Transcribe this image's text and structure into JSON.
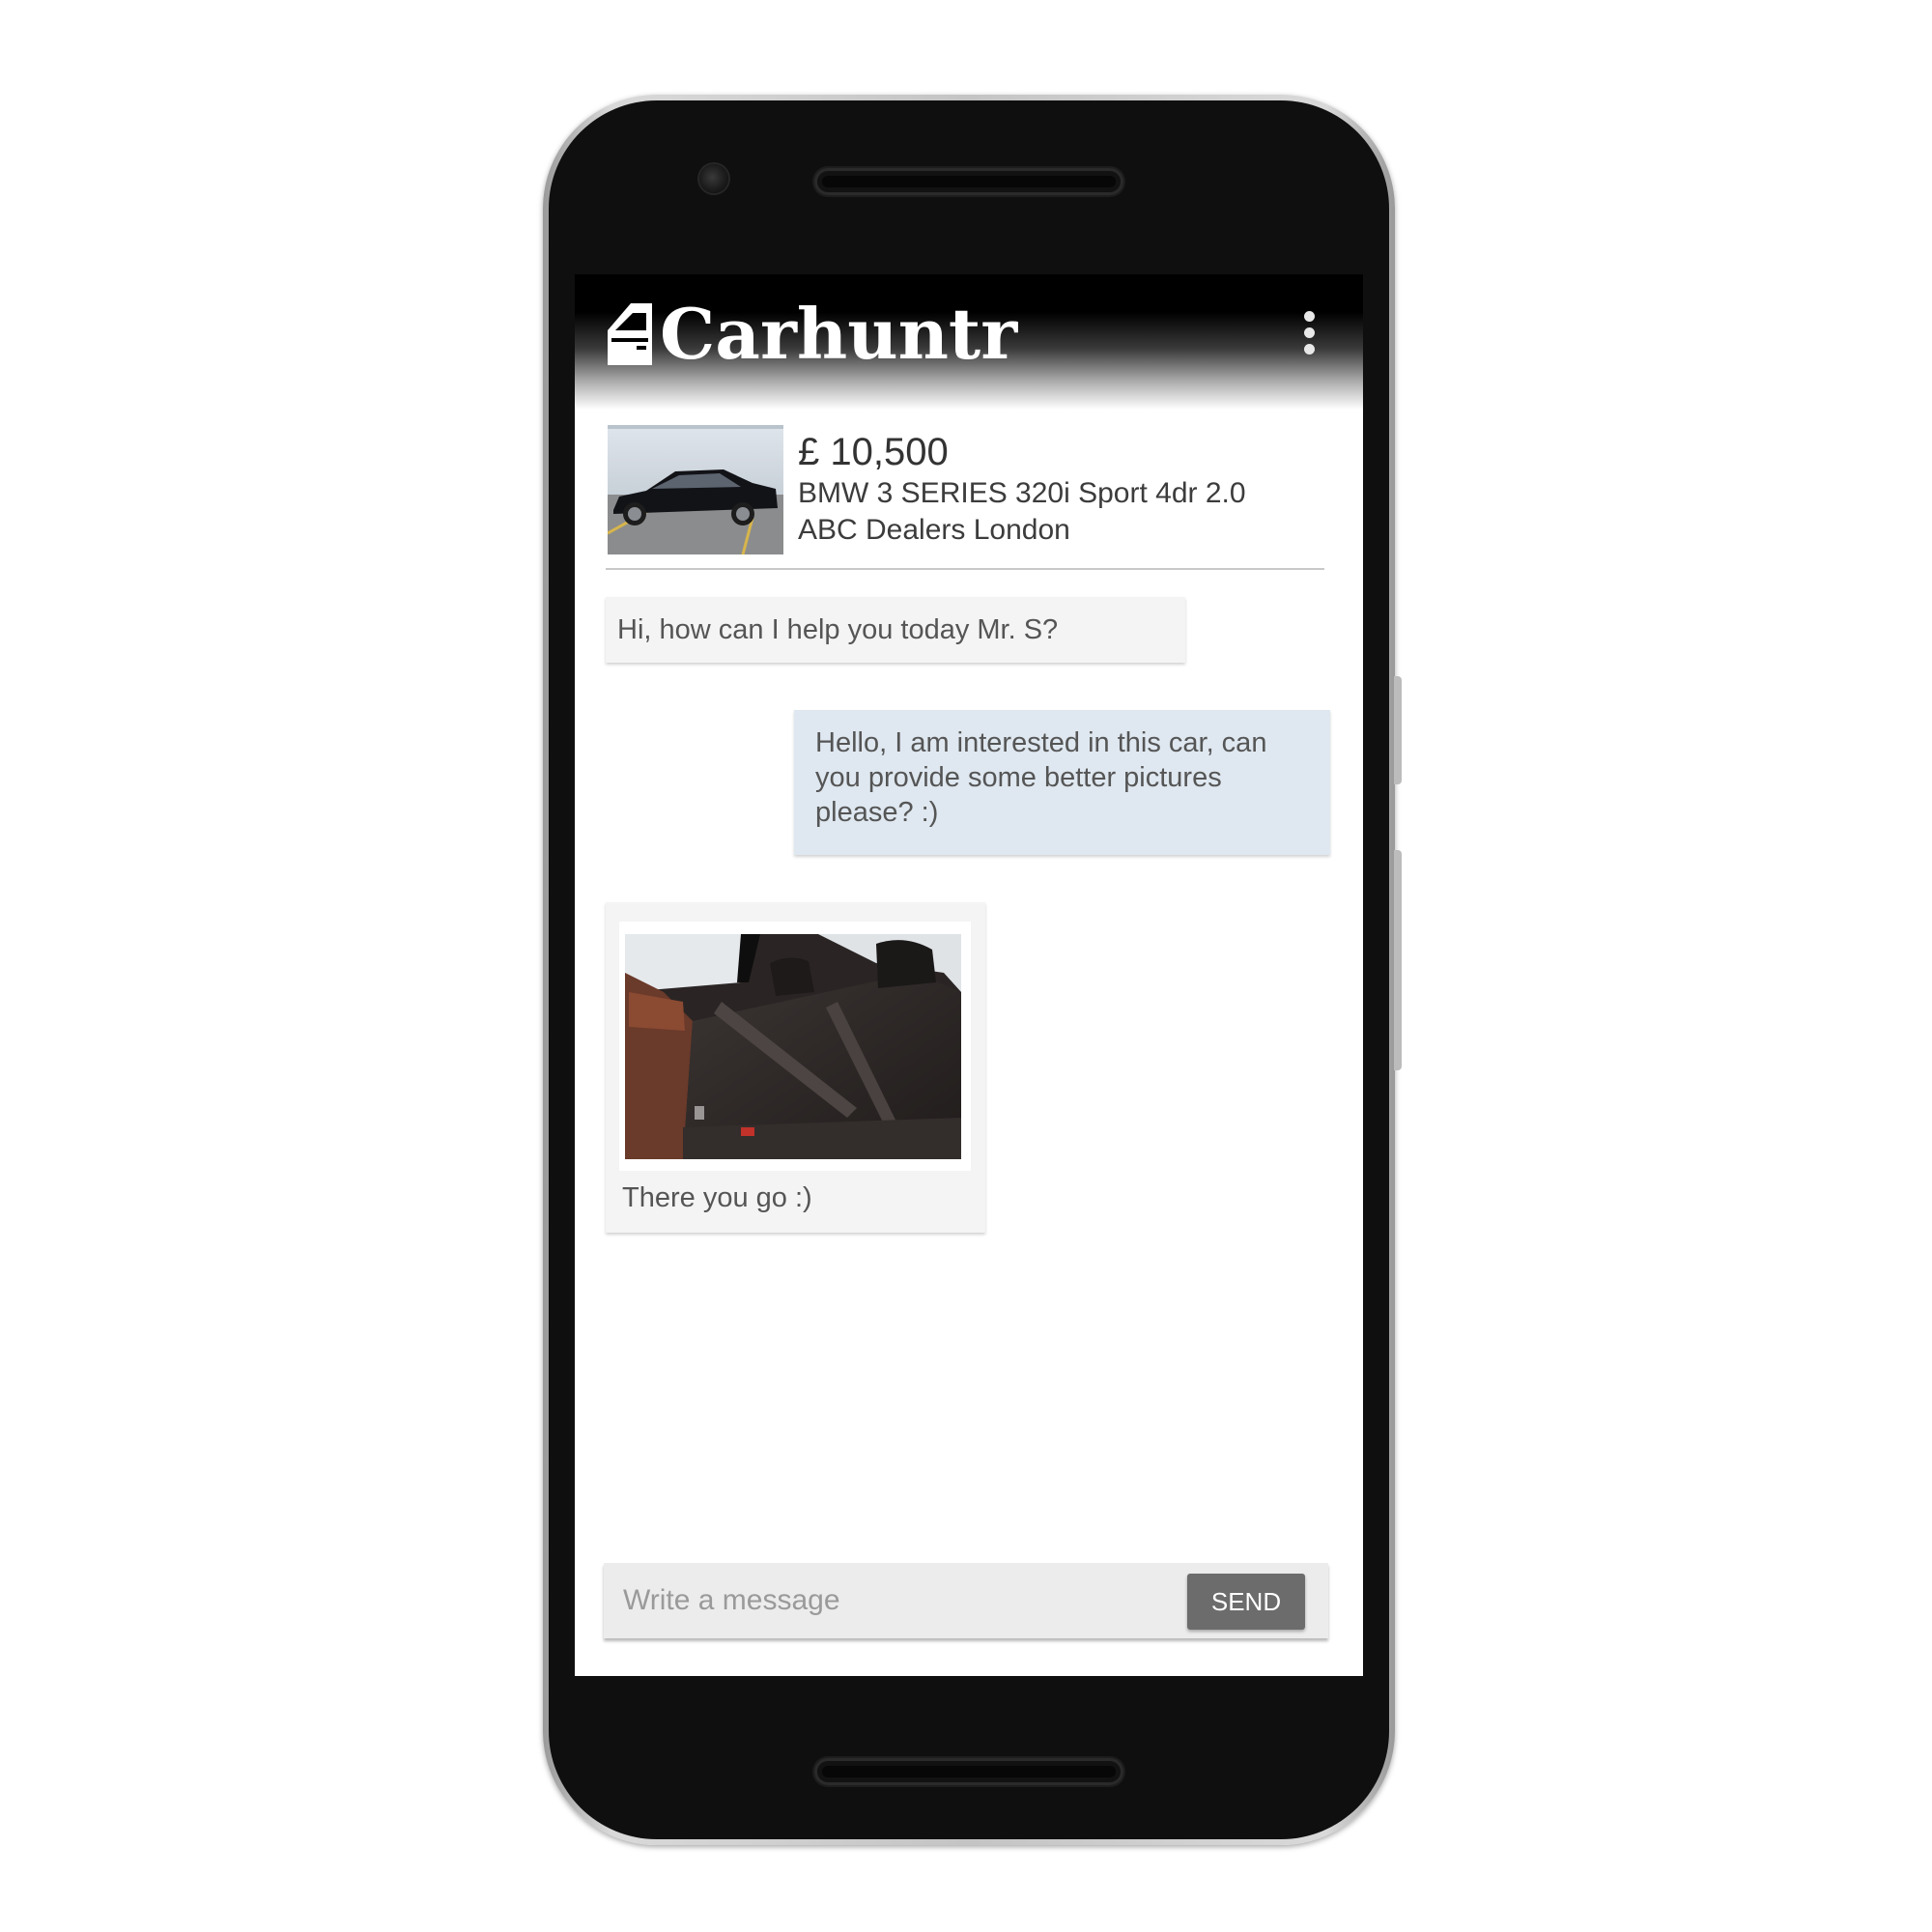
{
  "app": {
    "name": "Carhuntr",
    "logo_icon": "car-door-icon",
    "menu_icon": "more-vertical-icon",
    "colors": {
      "app_bar": "#000000",
      "incoming_bubble": "#f4f4f4",
      "outgoing_bubble": "#dfe8f0",
      "send_button": "#6c6c6c"
    }
  },
  "listing": {
    "price": "£ 10,500",
    "title": "BMW 3 SERIES 320i Sport 4dr 2.0",
    "dealer": "ABC Dealers London",
    "thumbnail_icon": "car-photo"
  },
  "messages": [
    {
      "direction": "incoming",
      "text": "Hi, how can I help you today Mr. S?"
    },
    {
      "direction": "outgoing",
      "text": "Hello, I am interested in this car, can you provide some better pictures please? :)"
    },
    {
      "direction": "incoming",
      "image": "car-interior-photo",
      "text": "There you go :)"
    }
  ],
  "composer": {
    "placeholder": "Write a message",
    "value": "",
    "send_label": "SEND"
  }
}
